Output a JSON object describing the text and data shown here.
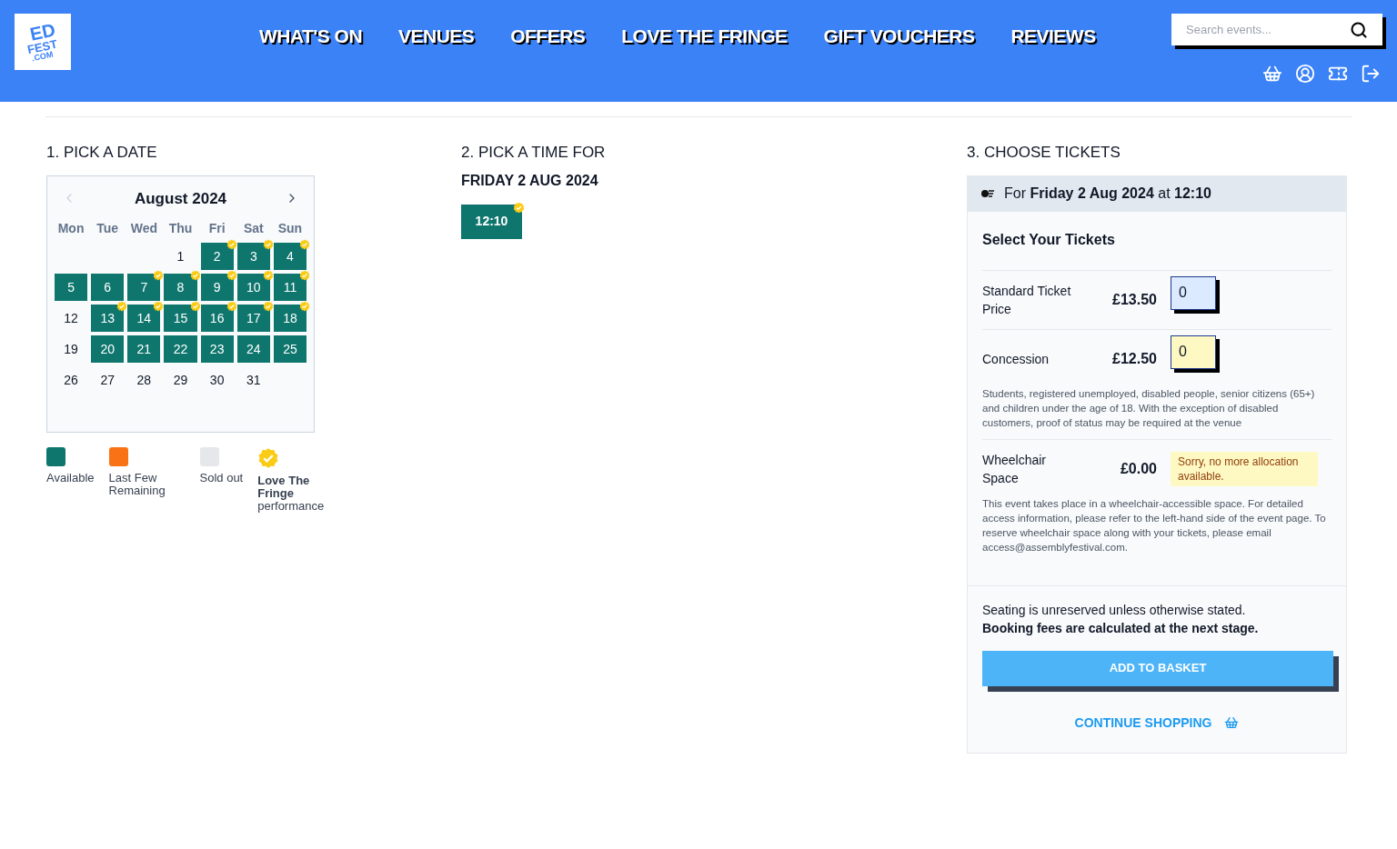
{
  "header": {
    "logo": {
      "top": "ED",
      "middle": "FEST",
      "bottom": ".COM"
    },
    "nav": [
      "WHAT'S ON",
      "VENUES",
      "OFFERS",
      "LOVE THE FRINGE",
      "GIFT VOUCHERS",
      "REVIEWS"
    ],
    "search": {
      "placeholder": "Search events..."
    }
  },
  "date_picker": {
    "heading": "1. PICK A DATE",
    "month": "August 2024",
    "weekdays": [
      "Mon",
      "Tue",
      "Wed",
      "Thu",
      "Fri",
      "Sat",
      "Sun"
    ],
    "weeks": [
      [
        {
          "kind": "empty"
        },
        {
          "kind": "empty"
        },
        {
          "kind": "empty"
        },
        {
          "kind": "day",
          "label": "1",
          "available": false,
          "fringe": false
        },
        {
          "kind": "day",
          "label": "2",
          "available": true,
          "fringe": true
        },
        {
          "kind": "day",
          "label": "3",
          "available": true,
          "fringe": true
        },
        {
          "kind": "day",
          "label": "4",
          "available": true,
          "fringe": true
        }
      ],
      [
        {
          "kind": "day",
          "label": "5",
          "available": true,
          "fringe": false
        },
        {
          "kind": "day",
          "label": "6",
          "available": true,
          "fringe": false
        },
        {
          "kind": "day",
          "label": "7",
          "available": true,
          "fringe": true
        },
        {
          "kind": "day",
          "label": "8",
          "available": true,
          "fringe": true
        },
        {
          "kind": "day",
          "label": "9",
          "available": true,
          "fringe": true
        },
        {
          "kind": "day",
          "label": "10",
          "available": true,
          "fringe": true
        },
        {
          "kind": "day",
          "label": "11",
          "available": true,
          "fringe": true
        }
      ],
      [
        {
          "kind": "day",
          "label": "12",
          "available": false,
          "fringe": false
        },
        {
          "kind": "day",
          "label": "13",
          "available": true,
          "fringe": true
        },
        {
          "kind": "day",
          "label": "14",
          "available": true,
          "fringe": true
        },
        {
          "kind": "day",
          "label": "15",
          "available": true,
          "fringe": true
        },
        {
          "kind": "day",
          "label": "16",
          "available": true,
          "fringe": true
        },
        {
          "kind": "day",
          "label": "17",
          "available": true,
          "fringe": true
        },
        {
          "kind": "day",
          "label": "18",
          "available": true,
          "fringe": true
        }
      ],
      [
        {
          "kind": "day",
          "label": "19",
          "available": false,
          "fringe": false
        },
        {
          "kind": "day",
          "label": "20",
          "available": true,
          "fringe": false
        },
        {
          "kind": "day",
          "label": "21",
          "available": true,
          "fringe": false
        },
        {
          "kind": "day",
          "label": "22",
          "available": true,
          "fringe": false
        },
        {
          "kind": "day",
          "label": "23",
          "available": true,
          "fringe": false
        },
        {
          "kind": "day",
          "label": "24",
          "available": true,
          "fringe": false
        },
        {
          "kind": "day",
          "label": "25",
          "available": true,
          "fringe": false
        }
      ],
      [
        {
          "kind": "day",
          "label": "26",
          "available": false,
          "fringe": false
        },
        {
          "kind": "day",
          "label": "27",
          "available": false,
          "fringe": false
        },
        {
          "kind": "day",
          "label": "28",
          "available": false,
          "fringe": false
        },
        {
          "kind": "day",
          "label": "29",
          "available": false,
          "fringe": false
        },
        {
          "kind": "day",
          "label": "30",
          "available": false,
          "fringe": false
        },
        {
          "kind": "day",
          "label": "31",
          "available": false,
          "fringe": false
        }
      ]
    ],
    "legend": [
      {
        "kind": "swatch",
        "color": "#0f766e",
        "label": "Available"
      },
      {
        "kind": "swatch",
        "color": "#f97316",
        "label": "Last Few Remaining"
      },
      {
        "kind": "swatch",
        "color": "#e5e7eb",
        "label": "Sold out"
      },
      {
        "kind": "badge",
        "label": "**Love The Fringe** performance"
      }
    ]
  },
  "time_picker": {
    "heading": "2. PICK A TIME FOR",
    "date": "FRIDAY 2 AUG 2024",
    "times": [
      {
        "label": "12:10",
        "fringe": true
      }
    ]
  },
  "tickets": {
    "heading": "3. CHOOSE TICKETS",
    "summary": "For **Friday 2 Aug 2024** at **12:10**",
    "subheading": "Select Your Tickets",
    "rows": [
      {
        "kind": "input",
        "name": "Standard Ticket Price",
        "price": "£13.50",
        "value": "0",
        "color": "#dbeafe"
      },
      {
        "kind": "input",
        "name": "Concession",
        "price": "£12.50",
        "value": "0",
        "color": "#fef9c3",
        "note": "Students, registered unemployed, disabled people, senior citizens (65+) and children under the age of 18. With the exception of disabled customers, proof of status may be required at the venue"
      },
      {
        "kind": "message",
        "name": "Wheelchair Space",
        "price": "£0.00",
        "message": "Sorry, no more allocation available.",
        "note": "This event takes place in a wheelchair-accessible space. For detailed access information, please refer to the left-hand side of the event page. To reserve wheelchair space along with your tickets, please email access@assemblyfestival.com."
      }
    ],
    "footer_notes": [
      {
        "text": "Seating is unreserved unless otherwise stated.",
        "bold": false
      },
      {
        "text": "Booking fees are calculated at the next stage.",
        "bold": true
      }
    ],
    "add_button": "ADD TO BASKET",
    "continue_link": "CONTINUE SHOPPING"
  }
}
